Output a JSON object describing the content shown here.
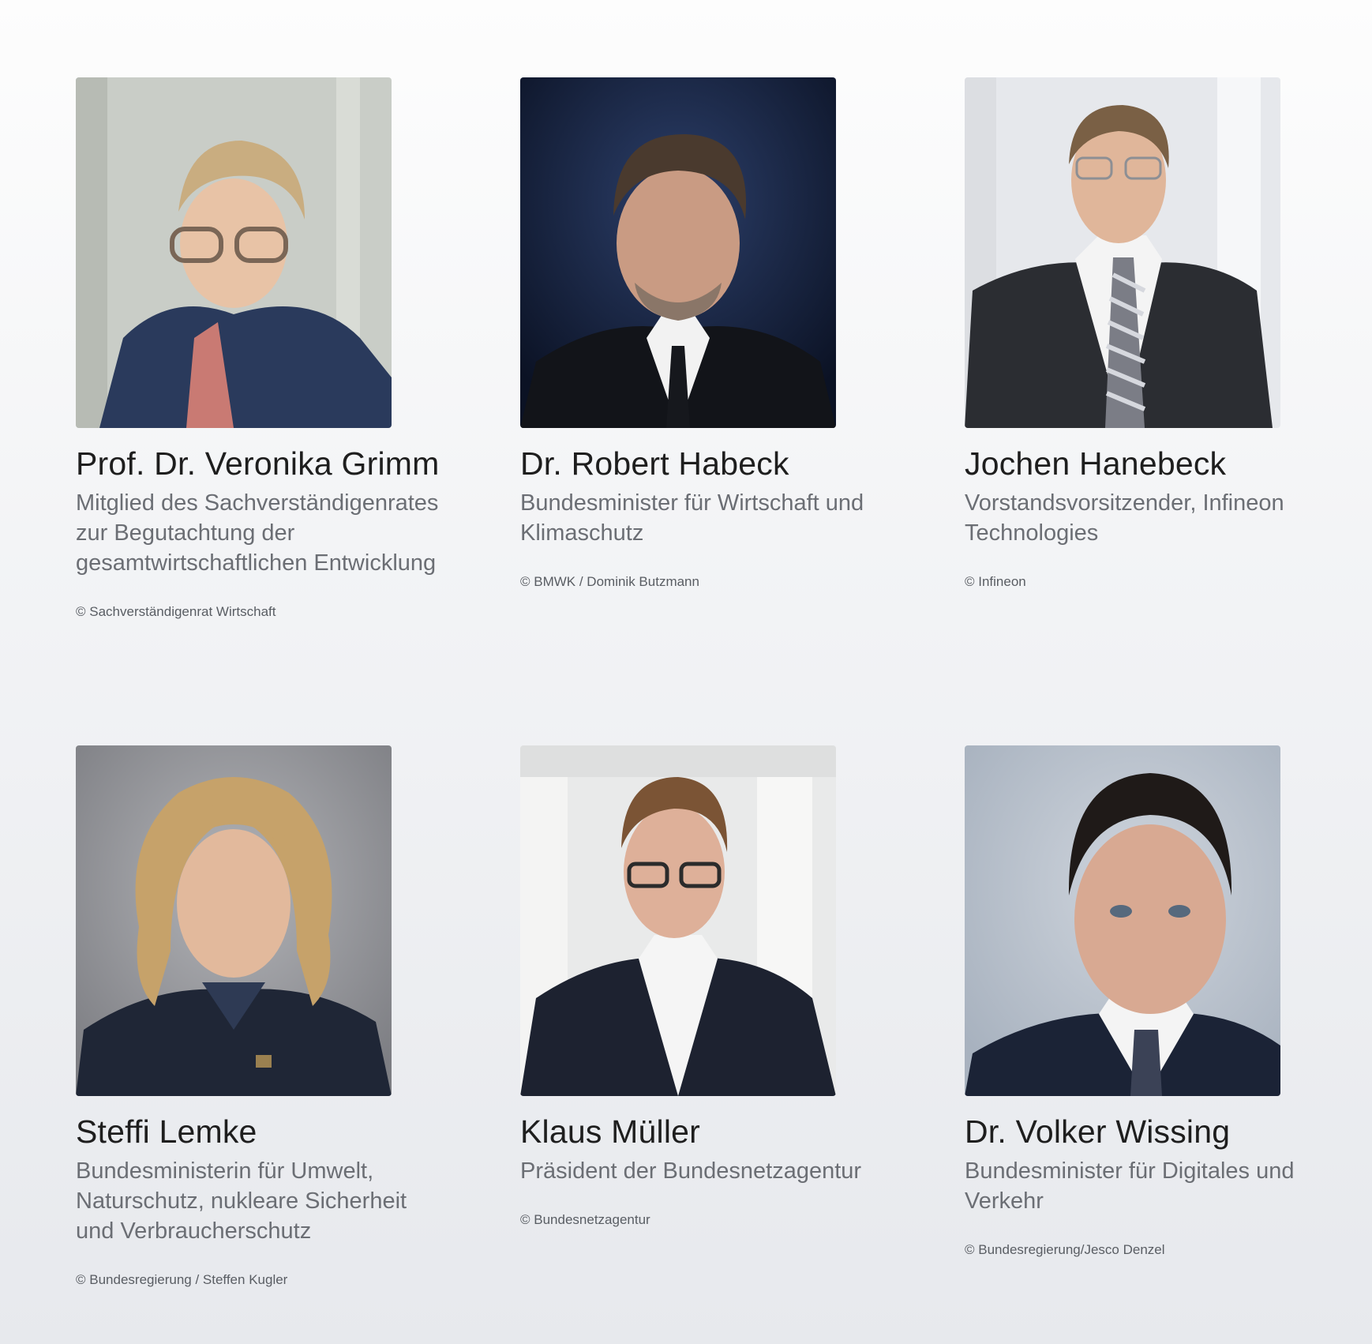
{
  "people": [
    {
      "name": "Prof. Dr. Veronika Grimm",
      "role": "Mitglied des Sachverständigenrates zur Begutachtung der gesamtwirtschaftlichen Entwicklung",
      "credit": "© Sachverständigenrat Wirtschaft"
    },
    {
      "name": "Dr. Robert Habeck",
      "role": "Bundesminister für Wirtschaft und Klimaschutz",
      "credit": "© BMWK / Dominik Butzmann"
    },
    {
      "name": "Jochen Hanebeck",
      "role": "Vorstandsvorsitzender, Infineon Technologies",
      "credit": "© Infineon"
    },
    {
      "name": "Steffi Lemke",
      "role": "Bundesministerin für Umwelt, Naturschutz, nukleare Sicherheit und Verbraucherschutz",
      "credit": "© Bundesregierung / Steffen Kugler"
    },
    {
      "name": "Klaus Müller",
      "role": "Präsident der Bundesnetzagentur",
      "credit": "© Bundesnetzagentur"
    },
    {
      "name": "Dr. Volker Wissing",
      "role": "Bundesminister für Digitales und Verkehr",
      "credit": "© Bundesregierung/Jesco Denzel"
    }
  ]
}
